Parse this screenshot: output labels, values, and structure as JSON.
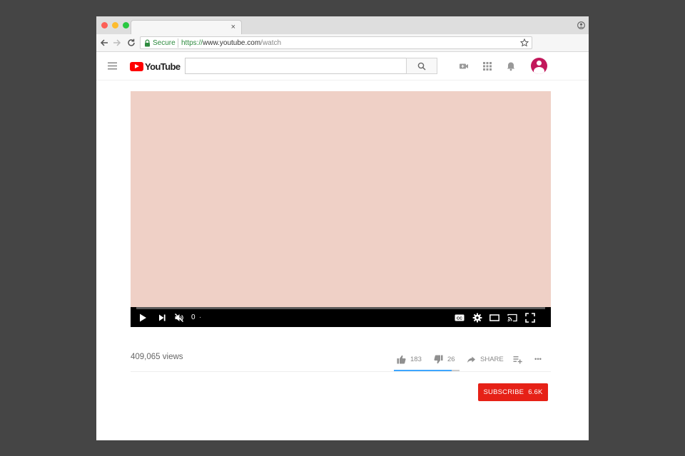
{
  "browser": {
    "tab": {
      "close_label": "×"
    },
    "address": {
      "secure_label": "Secure",
      "url_scheme": "https://",
      "url_host": "www.youtube.com",
      "url_path": "/watch"
    }
  },
  "header": {
    "logo_text": "YouTube",
    "search_placeholder": ""
  },
  "player": {
    "time": "0",
    "time_separator": "·",
    "progress_fraction": 0
  },
  "info": {
    "views": "409,065 views",
    "likes": "183",
    "dislikes": "26",
    "share_label": "SHARE",
    "more_label": "•••",
    "like_ratio": 0.876
  },
  "subscribe": {
    "label": "SUBSCRIBE",
    "count": "6.6K"
  },
  "colors": {
    "brand_red": "#ff0000",
    "subscribe_red": "#e62117",
    "video_placeholder": "#efd0c6",
    "sentiment_blue": "#3ea6ff"
  }
}
